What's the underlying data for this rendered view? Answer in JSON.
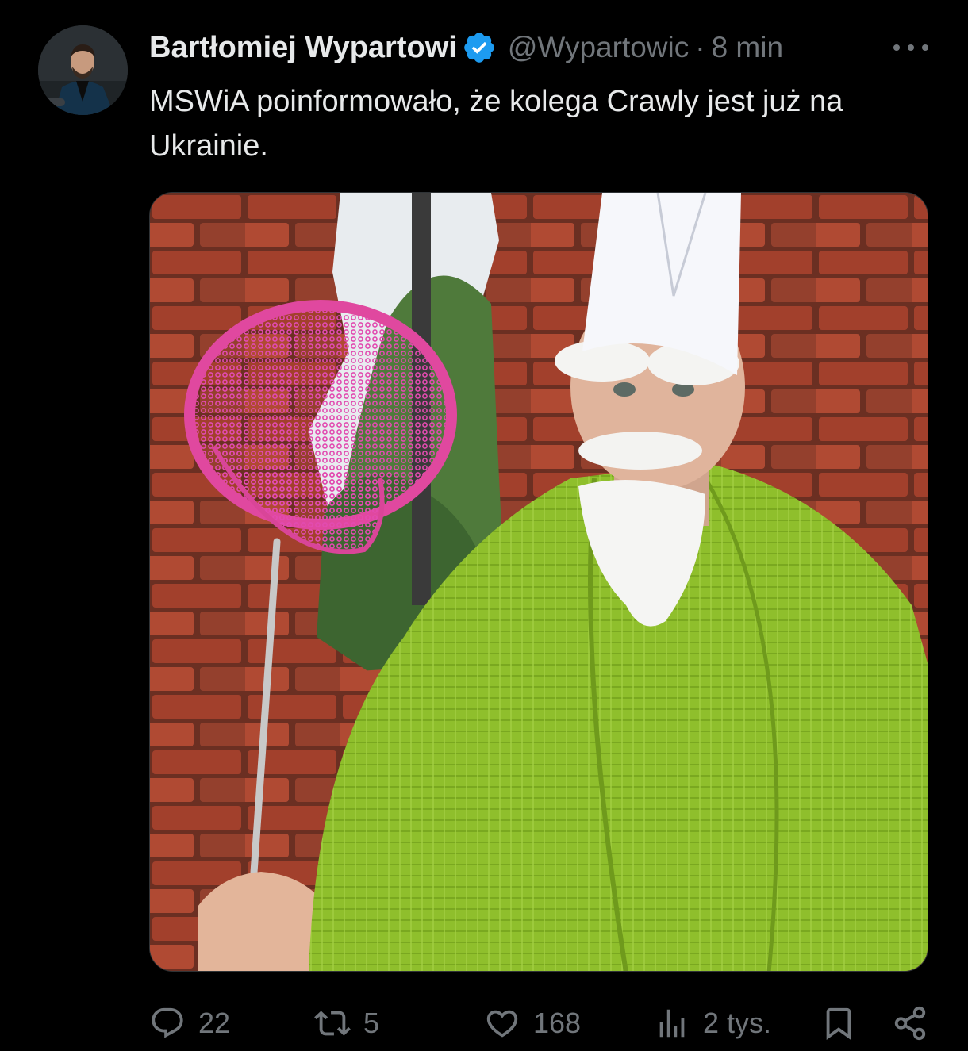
{
  "author": {
    "display_name": "Bartłomiej Wypartowi",
    "handle": "@Wypartowic",
    "separator": "·",
    "time_ago": "8 min",
    "verified": true,
    "verified_color": "#1d9bf0"
  },
  "tweet": {
    "text": "MSWiA poinformowało, że kolega Crawly jest już na Ukrainie."
  },
  "actions": {
    "replies": "22",
    "reposts": "5",
    "likes": "168",
    "views": "2 tys."
  },
  "icons": {
    "more": "more-horizontal-icon",
    "reply": "reply-bubble-icon",
    "repost": "repost-arrows-icon",
    "like": "heart-icon",
    "views": "bar-chart-icon",
    "bookmark": "bookmark-icon",
    "share": "share-icon"
  },
  "colors": {
    "background": "#000000",
    "text_primary": "#e7e9ea",
    "text_secondary": "#71767b"
  }
}
